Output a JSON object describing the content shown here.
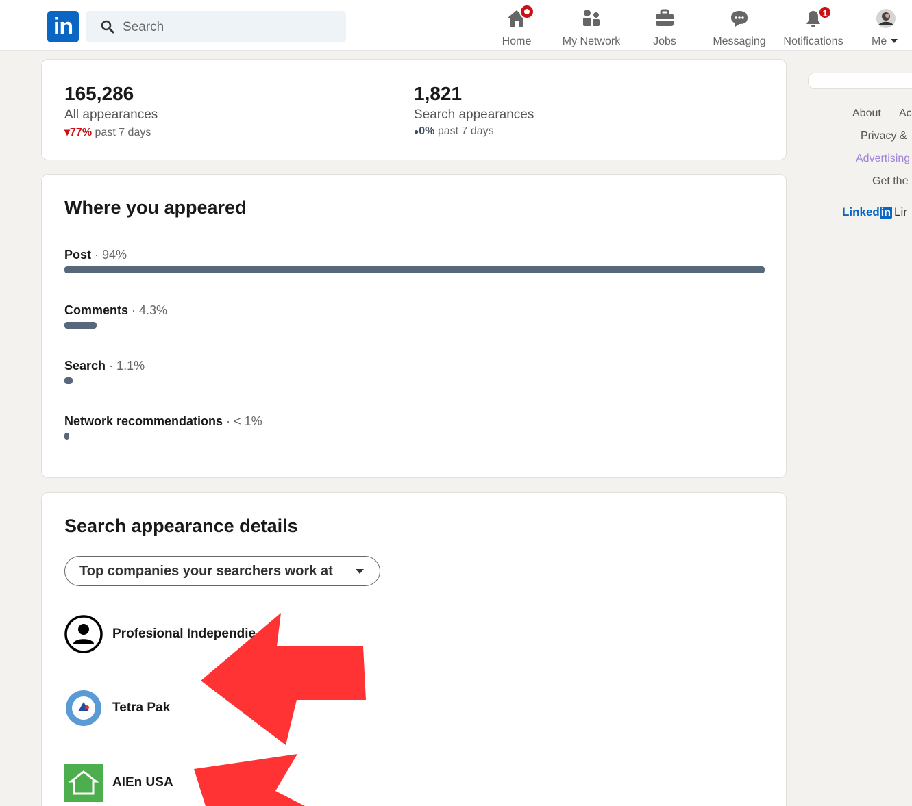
{
  "nav": {
    "logo": "in",
    "search_placeholder": "Search",
    "items": [
      {
        "label": "Home",
        "icon": "home-icon"
      },
      {
        "label": "My Network",
        "icon": "my-network-icon"
      },
      {
        "label": "Jobs",
        "icon": "jobs-icon"
      },
      {
        "label": "Messaging",
        "icon": "messaging-icon"
      },
      {
        "label": "Notifications",
        "icon": "notifications-icon",
        "badge": "1"
      },
      {
        "label": "Me",
        "icon": "avatar"
      }
    ]
  },
  "stats": {
    "all": {
      "value": "165,286",
      "label": "All appearances",
      "trend_value": "77%",
      "trend_suffix": "past 7 days",
      "trend_marker": "▾"
    },
    "search": {
      "value": "1,821",
      "label": "Search appearances",
      "trend_value": "0%",
      "trend_suffix": "past 7 days",
      "trend_marker": "●"
    }
  },
  "where": {
    "title": "Where you appeared",
    "rows": [
      {
        "name": "Post",
        "value_text": "· 94%",
        "fraction": 0.94
      },
      {
        "name": "Comments",
        "value_text": "· 4.3%",
        "fraction": 0.043
      },
      {
        "name": "Search",
        "value_text": "· 1.1%",
        "fraction": 0.011
      },
      {
        "name": "Network recommendations",
        "value_text": "· < 1%",
        "fraction": 0.006
      }
    ]
  },
  "search_details": {
    "title": "Search appearance details",
    "dropdown_label": "Top companies your searchers work at",
    "companies": [
      "Profesional Independie",
      "Tetra Pak",
      "AlEn USA"
    ]
  },
  "right_rail": {
    "links": [
      "About",
      "Ac",
      "Privacy &",
      "Advertising",
      "Get the"
    ],
    "brand_text": "Linked",
    "brand_box": "in",
    "brand_after": "Lir"
  },
  "colors": {
    "linkedin_blue": "#0a66c2",
    "badge_red": "#cc1016",
    "bar": "#56687a",
    "arrow_red": "#ff3333"
  }
}
